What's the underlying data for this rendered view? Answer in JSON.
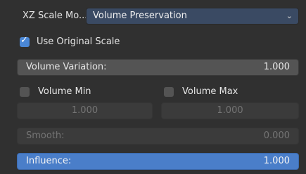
{
  "header": {
    "xz_scale_label": "XZ Scale Mo...",
    "xz_scale_value": "Volume Preservation",
    "chevron_icon": "chevron-down-icon"
  },
  "use_original_scale": {
    "label": "Use Original Scale",
    "checked": true
  },
  "volume_variation": {
    "label": "Volume Variation:",
    "value": "1.000"
  },
  "volume_min": {
    "label": "Volume Min",
    "checked": false,
    "value": "1.000"
  },
  "volume_max": {
    "label": "Volume Max",
    "checked": false,
    "value": "1.000"
  },
  "smooth": {
    "label": "Smooth:",
    "value": "0.000"
  },
  "influence": {
    "label": "Influence:",
    "value": "1.000"
  },
  "colors": {
    "panel_bg": "#303030",
    "accent_blue": "#4a7ec9",
    "dropdown_bg": "#3a4a63"
  }
}
